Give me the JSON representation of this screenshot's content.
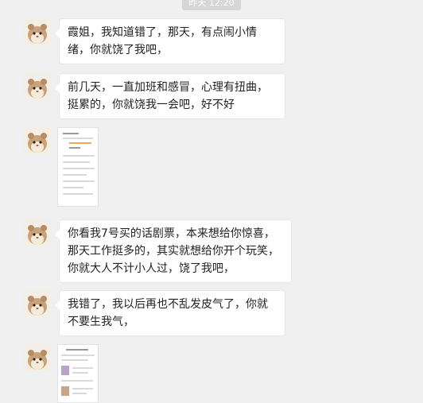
{
  "chat": {
    "timestamp": "昨天 12:20",
    "messages": [
      {
        "text": "霞姐，我知道错了，那天，有点闹小情绪，你就饶了我吧，"
      },
      {
        "text": "前几天，一直加班和感冒，心理有扭曲，挺累的，你就饶我一会吧，好不好"
      },
      {
        "text": "你看我7号买的话剧票，本来想给你惊喜，那天工作挺多的，其实就想给你开个玩笑，你就大人不计小人过，饶了我吧，"
      },
      {
        "text": "我错了，我以后再也不乱发皮气了，你就不要生我气，"
      }
    ]
  }
}
